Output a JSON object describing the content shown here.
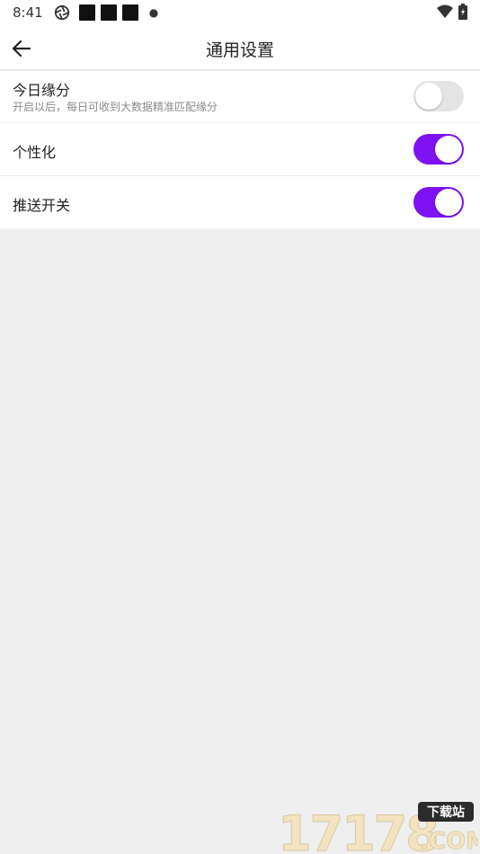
{
  "status_bar": {
    "time": "8:41",
    "icons": [
      "aperture-icon",
      "square-icon",
      "square-icon",
      "square-icon",
      "dot-icon",
      "wifi-icon",
      "battery-icon"
    ]
  },
  "header": {
    "title": "通用设置",
    "back_icon": "arrow-left-icon"
  },
  "settings": [
    {
      "label": "今日缘分",
      "description": "开启以后，每日可收到大数据精准匹配缘分",
      "enabled": false
    },
    {
      "label": "个性化",
      "description": "",
      "enabled": true
    },
    {
      "label": "推送开关",
      "description": "",
      "enabled": true
    }
  ],
  "colors": {
    "accent": "#7e12f2",
    "toggle_off": "#e4e4e4",
    "background": "#efefef"
  },
  "watermark": {
    "logo_text": "17178",
    "badge": "下载站",
    "suffix": ".COM"
  }
}
